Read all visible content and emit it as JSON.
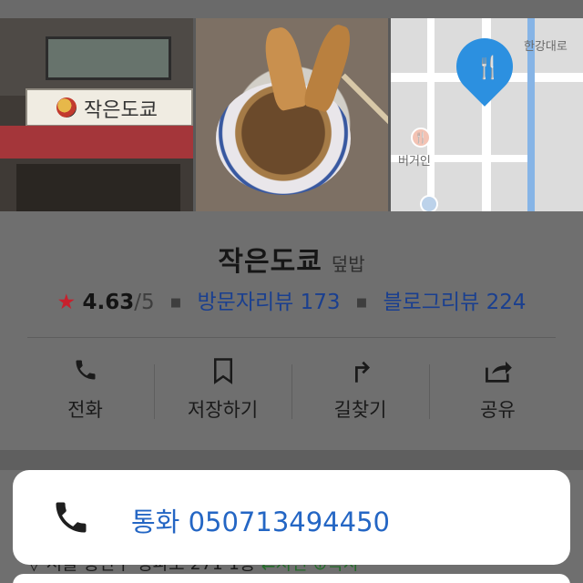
{
  "photos": {
    "storefront_sign": "작은도쿄",
    "map_labels": [
      "한강대로",
      "버거인"
    ]
  },
  "place": {
    "name": "작은도쿄",
    "category": "덮밥",
    "rating": "4.63",
    "rating_max": "/5",
    "visitor_reviews": "방문자리뷰 173",
    "blog_reviews": "블로그리뷰 224"
  },
  "actions": [
    {
      "label": "전화",
      "icon": "phone-icon"
    },
    {
      "label": "저장하기",
      "icon": "bookmark-icon"
    },
    {
      "label": "길찾기",
      "icon": "directions-icon"
    },
    {
      "label": "공유",
      "icon": "share-icon"
    }
  ],
  "address": {
    "text": "서울 용산구 청파로 271 1층",
    "extra1": "⇄지번",
    "extra2": "⊕복사"
  },
  "call_sheet": {
    "label": "통화 050713494450"
  },
  "colors": {
    "accent_blue": "#2466c4",
    "star_red": "#c8202c",
    "dim_overlay": "#6f6f6f"
  }
}
